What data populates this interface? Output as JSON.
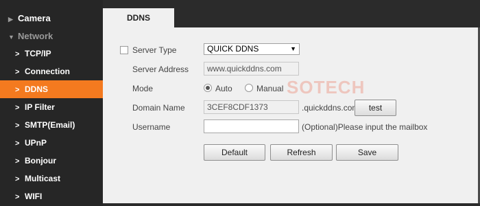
{
  "sidebar": {
    "camera": "Camera",
    "network": "Network",
    "items": [
      {
        "label": "TCP/IP"
      },
      {
        "label": "Connection"
      },
      {
        "label": "DDNS"
      },
      {
        "label": "IP Filter"
      },
      {
        "label": "SMTP(Email)"
      },
      {
        "label": "UPnP"
      },
      {
        "label": "Bonjour"
      },
      {
        "label": "Multicast"
      },
      {
        "label": "WIFI"
      }
    ]
  },
  "tab": {
    "label": "DDNS"
  },
  "form": {
    "server_type_label": "Server Type",
    "server_type_value": "QUICK DDNS",
    "server_address_label": "Server Address",
    "server_address_value": "www.quickddns.com",
    "mode_label": "Mode",
    "mode_auto": "Auto",
    "mode_manual": "Manual",
    "domain_name_label": "Domain Name",
    "domain_name_value": "3CEF8CDF1373",
    "domain_suffix": ".quickddns.com",
    "test_button": "test",
    "username_label": "Username",
    "username_value": "",
    "username_hint": "(Optional)Please input the mailbox"
  },
  "buttons": {
    "default": "Default",
    "refresh": "Refresh",
    "save": "Save"
  },
  "watermark": "SOTECH",
  "colors": {
    "accent": "#f47a1f",
    "sidebar_bg": "#262626",
    "content_bg": "#f0f0f0"
  }
}
